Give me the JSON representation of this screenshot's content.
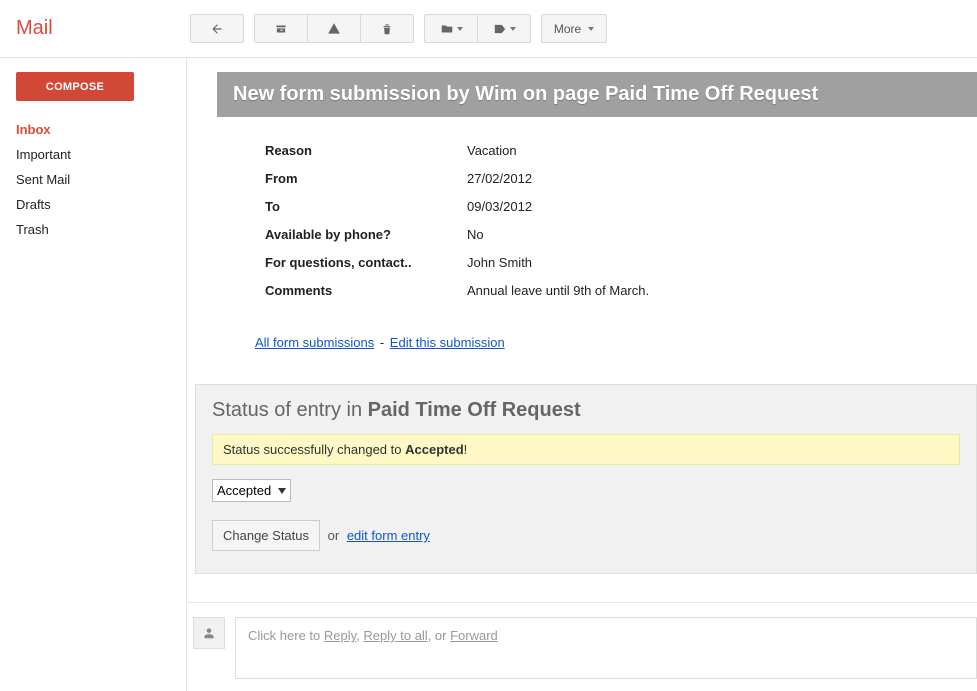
{
  "brand": "Mail",
  "toolbar": {
    "more_label": "More"
  },
  "sidebar": {
    "compose_label": "COMPOSE",
    "items": [
      {
        "label": "Inbox",
        "active": true
      },
      {
        "label": "Important",
        "active": false
      },
      {
        "label": "Sent Mail",
        "active": false
      },
      {
        "label": "Drafts",
        "active": false
      },
      {
        "label": "Trash",
        "active": false
      }
    ]
  },
  "message": {
    "header": "New form submission by Wim on page Paid Time Off Request",
    "fields": [
      {
        "label": "Reason",
        "value": "Vacation"
      },
      {
        "label": "From",
        "value": "27/02/2012"
      },
      {
        "label": "To",
        "value": "09/03/2012"
      },
      {
        "label": "Available by phone?",
        "value": "No"
      },
      {
        "label": "For questions, contact..",
        "value": "John Smith"
      },
      {
        "label": "Comments",
        "value": "Annual leave until 9th of March."
      }
    ],
    "link_all": "All form submissions",
    "link_edit": "Edit this submission"
  },
  "status_panel": {
    "title_prefix": "Status of entry in ",
    "title_strong": "Paid Time Off Request",
    "alert_prefix": "Status successfully changed to ",
    "alert_strong": "Accepted",
    "alert_suffix": "!",
    "select_value": "Accepted",
    "change_button": "Change Status",
    "or_text": "or",
    "edit_link": "edit form entry"
  },
  "reply": {
    "prefix": "Click here to ",
    "reply": "Reply",
    "sep1": ", ",
    "reply_all": "Reply to all",
    "sep2": ", or ",
    "forward": "Forward"
  }
}
